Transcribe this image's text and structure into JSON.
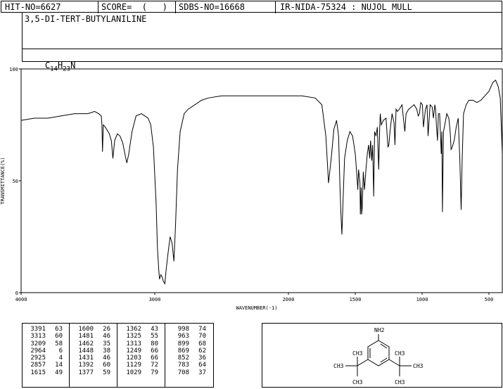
{
  "header": {
    "hit_no": "HIT-NO=6627",
    "score": "SCORE=  (   )",
    "sdbs_no": "SDBS-NO=16668",
    "ir_nida": "IR-NIDA-75324 : NUJOL MULL"
  },
  "compound": {
    "name": "3,5-DI-TERT-BUTYLANILINE",
    "formula_parts": [
      "C",
      "14",
      "H",
      "23",
      "N"
    ]
  },
  "chart_data": {
    "type": "line",
    "xlabel": "WAVENUMBER(-1)",
    "ylabel": "TRANSMITTANCE(%)",
    "xlim": [
      4000,
      400
    ],
    "ylim": [
      0,
      100
    ],
    "x_ticks": [
      4000,
      3000,
      2000,
      1500,
      1000,
      500
    ],
    "y_ticks": [
      0,
      50,
      100
    ],
    "grid": false,
    "series": [
      {
        "x": [
          4000,
          3900,
          3800,
          3700,
          3600,
          3500,
          3450,
          3420,
          3400,
          3395,
          3391,
          3385,
          3370,
          3340,
          3325,
          3313,
          3300,
          3280,
          3260,
          3240,
          3220,
          3209,
          3195,
          3170,
          3140,
          3100,
          3050,
          3030,
          3010,
          2990,
          2980,
          2970,
          2964,
          2955,
          2945,
          2935,
          2925,
          2915,
          2900,
          2885,
          2870,
          2857,
          2845,
          2830,
          2810,
          2780,
          2750,
          2700,
          2650,
          2600,
          2500,
          2400,
          2300,
          2200,
          2100,
          2000,
          1900,
          1800,
          1750,
          1720,
          1700,
          1680,
          1660,
          1640,
          1625,
          1615,
          1608,
          1600,
          1592,
          1580,
          1560,
          1540,
          1520,
          1500,
          1490,
          1481,
          1475,
          1465,
          1462,
          1456,
          1452,
          1448,
          1440,
          1431,
          1420,
          1410,
          1400,
          1392,
          1385,
          1377,
          1370,
          1362,
          1355,
          1345,
          1335,
          1325,
          1318,
          1313,
          1305,
          1290,
          1270,
          1255,
          1249,
          1240,
          1225,
          1210,
          1203,
          1195,
          1185,
          1170,
          1150,
          1140,
          1129,
          1120,
          1100,
          1080,
          1060,
          1040,
          1029,
          1020,
          1010,
          998,
          990,
          975,
          963,
          955,
          940,
          925,
          915,
          905,
          899,
          893,
          885,
          878,
          869,
          862,
          857,
          852,
          848,
          840,
          830,
          815,
          800,
          790,
          783,
          775,
          760,
          745,
          730,
          718,
          708,
          700,
          690,
          670,
          650,
          620,
          590,
          560,
          530,
          500,
          470,
          450,
          430,
          415,
          400
        ],
        "y": [
          77,
          78,
          78,
          79,
          80,
          80,
          81,
          80,
          79,
          75,
          63,
          75,
          74,
          71,
          68,
          60,
          68,
          71,
          70,
          67,
          61,
          58,
          62,
          72,
          79,
          80,
          78,
          75,
          65,
          40,
          20,
          10,
          6,
          8,
          7,
          5,
          4,
          10,
          18,
          25,
          22,
          14,
          30,
          55,
          72,
          80,
          82,
          84,
          86,
          87,
          88,
          88,
          88,
          88,
          88,
          88,
          88,
          87,
          84,
          70,
          49,
          60,
          73,
          77,
          70,
          49,
          36,
          26,
          40,
          60,
          68,
          72,
          70,
          62,
          54,
          46,
          55,
          49,
          35,
          47,
          35,
          38,
          54,
          46,
          55,
          62,
          66,
          60,
          68,
          59,
          66,
          43,
          72,
          70,
          74,
          55,
          72,
          80,
          75,
          77,
          78,
          65,
          66,
          72,
          80,
          76,
          66,
          82,
          81,
          82,
          84,
          78,
          72,
          80,
          82,
          83,
          84,
          82,
          79,
          80,
          85,
          84,
          74,
          82,
          84,
          70,
          84,
          83,
          78,
          84,
          82,
          75,
          68,
          80,
          80,
          70,
          62,
          72,
          36,
          72,
          75,
          80,
          78,
          72,
          64,
          65,
          68,
          74,
          78,
          60,
          37,
          60,
          80,
          84,
          86,
          86,
          85,
          86,
          88,
          90,
          94,
          95,
          92,
          87,
          62
        ]
      }
    ]
  },
  "peak_table": {
    "columns": [
      [
        [
          "3391",
          "63"
        ],
        [
          "3313",
          "60"
        ],
        [
          "3209",
          "58"
        ],
        [
          "2964",
          "6"
        ],
        [
          "2925",
          "4"
        ],
        [
          "2857",
          "14"
        ],
        [
          "1615",
          "49"
        ]
      ],
      [
        [
          "1600",
          "26"
        ],
        [
          "1481",
          "46"
        ],
        [
          "1462",
          "35"
        ],
        [
          "1448",
          "38"
        ],
        [
          "1431",
          "46"
        ],
        [
          "1392",
          "60"
        ],
        [
          "1377",
          "59"
        ]
      ],
      [
        [
          "1362",
          "43"
        ],
        [
          "1325",
          "55"
        ],
        [
          "1313",
          "80"
        ],
        [
          "1249",
          "66"
        ],
        [
          "1203",
          "66"
        ],
        [
          "1129",
          "72"
        ],
        [
          "1029",
          "79"
        ]
      ],
      [
        [
          "998",
          "74"
        ],
        [
          "963",
          "70"
        ],
        [
          "899",
          "68"
        ],
        [
          "869",
          "62"
        ],
        [
          "852",
          "36"
        ],
        [
          "783",
          "64"
        ],
        [
          "708",
          "37"
        ]
      ]
    ]
  },
  "structure": {
    "labels": [
      "NH2",
      "CH3",
      "CH3",
      "CH3",
      "CH3",
      "CH3",
      "CH3"
    ]
  }
}
